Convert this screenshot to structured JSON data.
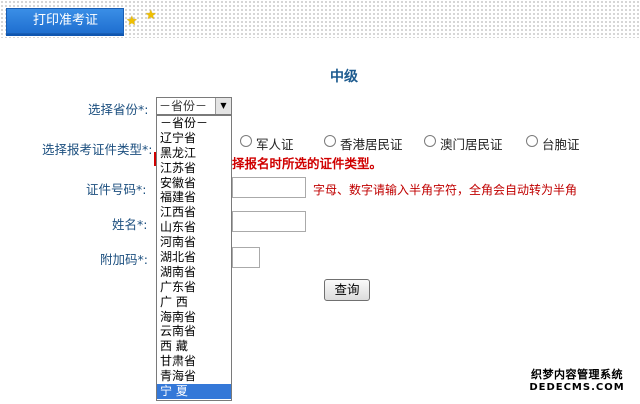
{
  "header": {
    "tab_label": "打印准考证"
  },
  "page_title": "中级",
  "form": {
    "province_label": "选择省份",
    "id_type_label": "选择报考证件类型",
    "id_number_label": "证件号码",
    "name_label": "姓名",
    "extra_code_label": "附加码",
    "required_mark": "*:",
    "province_select_value": "－省份－",
    "province_options": [
      "－省份－",
      "辽宁省",
      "黑龙江",
      "江苏省",
      "安徽省",
      "福建省",
      "江西省",
      "山东省",
      "河南省",
      "湖北省",
      "湖南省",
      "广东省",
      "广 西",
      "海南省",
      "云南省",
      "西 藏",
      "甘肃省",
      "青海省",
      "宁 夏"
    ],
    "province_selected_index": 18,
    "id_types": [
      "军人证",
      "香港居民证",
      "澳门居民证",
      "台胞证"
    ],
    "id_type_warning": "择报名时所选的证件类型。",
    "id_number_hint": "字母、数字请输入半角字符，全角会自动转为半角",
    "query_button": "查询"
  },
  "watermark": {
    "line1": "织梦内容管理系统",
    "line2": "DEDECMS.COM"
  },
  "colors": {
    "tab_blue": "#1f6fd0",
    "label_blue": "#1c4f7f",
    "warning_red": "#d00000",
    "selected_option": "#3478d8"
  }
}
